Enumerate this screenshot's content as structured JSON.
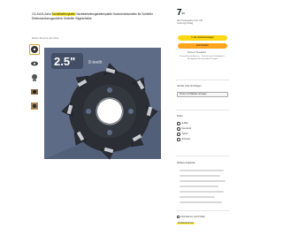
{
  "product": {
    "title_before": "2,5-Zoll 8-Zahn ",
    "title_highlight": "Schleifkettenplatte",
    "title_after": " Holzbearbeitungskettenplatte Holzschnitzscheibe für Schleifer Elektrowerkzeugzubehör Schleifer Sägescheibe",
    "sublink": "Marke: Besuche den Shop",
    "image_badge": "2.5\"",
    "image_badge_sub": "8-teeth",
    "thumbnails": [
      "thumb-saw-blade",
      "thumb-saw-blade-side",
      "thumb-saw-detail",
      "thumb-grinder-use",
      "thumb-wood-carving"
    ]
  },
  "buybox": {
    "price_whole": "7",
    "price_fraction": "99",
    "price_meta": "Alle Preisangaben inkl. USt",
    "delivery": "Lieferung Freitag",
    "add_to_cart": "In den Einkaufswagen",
    "buy_now": "Jetzt kaufen",
    "secure": "Sichere Transaktion",
    "info": "Versand durch Amazon · Verkauf durch Drittanbieter · Rückgaberecht innerhalb 30 Tagen"
  },
  "addon": {
    "label": "Auf die Liste hinzufügen",
    "select_value": "Preise und Rabatte anzeigen"
  },
  "share": {
    "title": "Teilen",
    "items": [
      "E-Mail",
      "Facebook",
      "Twitter",
      "Pinterest"
    ]
  },
  "other": {
    "title": "Weitere Angebote"
  },
  "footer": {
    "link": "Informationen zum Produkt",
    "highlight": "Produktsicherheit"
  },
  "colors": {
    "highlight": "#ffef3a",
    "cart_button": "#ffd814",
    "buy_button": "#ffa41c",
    "saw_blade": "#2b2e34",
    "image_bg": "#5e6b86"
  }
}
